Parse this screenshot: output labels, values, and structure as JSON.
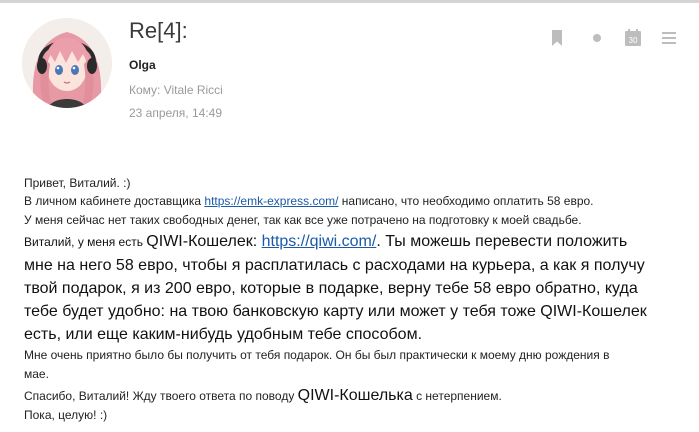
{
  "message": {
    "subject": "Re[4]:",
    "sender": "Olga",
    "recipient": "Кому: Vitale Ricci",
    "date": "23 апреля, 14:49",
    "calendar_day": "30"
  },
  "toolbar": {
    "icons": [
      "bookmark-icon",
      "dot-icon",
      "calendar-icon",
      "menu-icon"
    ]
  },
  "body": {
    "greeting": "Привет, Виталий. :)",
    "line2_pre": "В личном кабинете доставщика ",
    "line2_link": "https://emk-express.com/",
    "line2_post": " написано, что необходимо оплатить 58 евро.",
    "line3": "У меня сейчас нет таких свободных денег, так как все уже потрачено на подготовку к моей свадьбе.",
    "line4_small": "Виталий, у меня есть ",
    "line4_big": "QIWI-Кошелек: ",
    "line4_link": "https://qiwi.com/",
    "line4_post": ". Ты можешь перевести положить",
    "line5": "мне на него 58 евро, чтобы я расплатилась с расходами на курьера, а как я получу",
    "line6": "твой подарок, я из 200 евро, которые в подарке, верну тебе 58 евро обратно, куда",
    "line7": "тебе будет удобно: на твою банковскую карту или может у тебя тоже QIWI-Кошелек",
    "line8": "есть, или еще каким-нибудь удобным тебе способом.",
    "line9": "Мне очень приятно было бы получить от тебя подарок. Он бы был практически к моему дню рождения в",
    "line10": "мае.",
    "line11_pre": "Спасибо, Виталий! Жду твоего ответа по поводу ",
    "line11_big": "QIWI-Кошелька",
    "line11_post": " с нетерпением.",
    "line12": "Пока, целую! :)"
  },
  "colors": {
    "link": "#1a5aa8",
    "muted": "#9a9a9a",
    "icon": "#bdbdbd"
  }
}
